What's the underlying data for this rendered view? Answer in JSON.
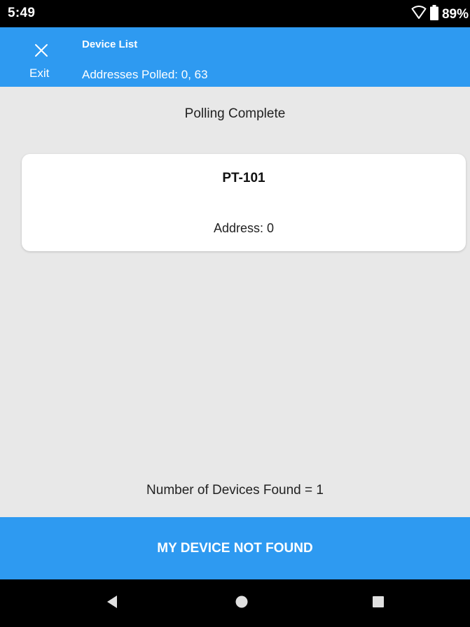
{
  "status_bar": {
    "time": "5:49",
    "battery": "89%"
  },
  "app_bar": {
    "exit_label": "Exit",
    "title": "Device List",
    "subtitle": "Addresses Polled: 0, 63",
    "color": "#2e9af1"
  },
  "main": {
    "status": "Polling Complete",
    "devices": [
      {
        "name": "PT-101",
        "address": "Address: 0"
      }
    ],
    "found_count_text": "Number of Devices Found = 1"
  },
  "actions": {
    "not_found_label": "MY DEVICE NOT FOUND"
  },
  "icons": {
    "wifi": "wifi-icon",
    "battery": "battery-icon",
    "close": "close-icon",
    "back": "back-icon",
    "home": "home-icon",
    "recents": "recents-icon"
  }
}
